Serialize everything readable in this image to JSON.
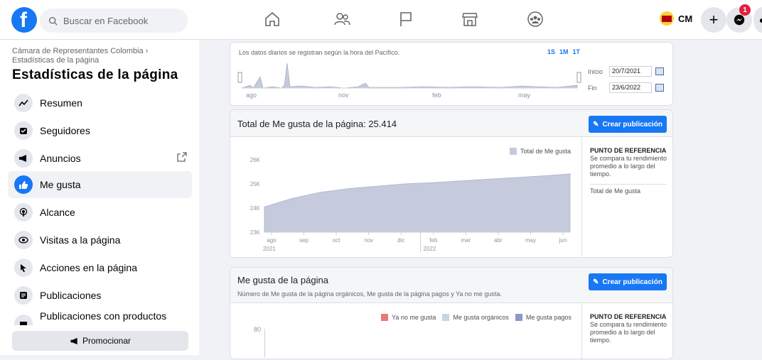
{
  "topbar": {
    "logo": "f",
    "search_placeholder": "Buscar en Facebook",
    "profile_name": "CM",
    "notif_count": "1"
  },
  "sidebar": {
    "breadcrumb": "Cámara de Representantes Colombia › Estadísticas de la página",
    "title": "Estadísticas de la página",
    "items": [
      {
        "label": "Resumen"
      },
      {
        "label": "Seguidores"
      },
      {
        "label": "Anuncios"
      },
      {
        "label": "Me gusta"
      },
      {
        "label": "Alcance"
      },
      {
        "label": "Visitas a la página"
      },
      {
        "label": "Acciones en la página"
      },
      {
        "label": "Publicaciones"
      },
      {
        "label": "Publicaciones con productos"
      }
    ],
    "promote_label": "Promocionar"
  },
  "timeline": {
    "note": "Los datos diarios se registran según la hora del Pacífico.",
    "ranges": [
      "1S",
      "1M",
      "1T"
    ],
    "ticks": [
      "ago",
      "nov",
      "feb",
      "may"
    ],
    "start_label": "Inicio",
    "start_value": "20/7/2021",
    "end_label": "Fin",
    "end_value": "23/6/2022"
  },
  "likes_card": {
    "title": "Total de Me gusta de la página: 25.414",
    "create_label": "Crear publicación",
    "ref_title": "PUNTO DE REFERENCIA",
    "ref_text": "Se compara tu rendimiento promedio a lo largo del tiempo.",
    "ref_series": "Total de Me gusta"
  },
  "likes_card2": {
    "title": "Me gusta de la página",
    "subtitle": "Número de Me gusta de la página orgánicos, Me gusta de la página pagos y Ya no me gusta.",
    "create_label": "Crear publicación",
    "ref_title": "PUNTO DE REFERENCIA",
    "ref_text": "Se compara tu rendimiento promedio a lo largo del tiempo.",
    "y_tick": "80"
  },
  "chart_data": [
    {
      "type": "area",
      "legend": [
        "Total de Me gusta"
      ],
      "yticks": [
        "26K",
        "25K",
        "24K",
        "23K"
      ],
      "ylim": [
        23000,
        26000
      ],
      "categories": [
        "ago",
        "sep",
        "oct",
        "nov",
        "dic",
        "feb",
        "mar",
        "abr",
        "may",
        "jun"
      ],
      "year_labels": [
        "2021",
        "2022"
      ],
      "x": [
        0,
        1,
        2,
        3,
        4,
        5,
        6,
        7,
        8,
        9,
        10,
        11
      ],
      "values": [
        24050,
        24400,
        24650,
        24800,
        24900,
        25000,
        25050,
        25120,
        25190,
        25260,
        25330,
        25414
      ],
      "color": "#c5cbdc"
    },
    {
      "type": "bar",
      "legend": [
        "Ya no me gusta",
        "Me gusta orgánicos",
        "Me gusta pagos"
      ],
      "legend_colors": [
        "#e87979",
        "#c7d3e6",
        "#8b9ac2"
      ]
    }
  ]
}
